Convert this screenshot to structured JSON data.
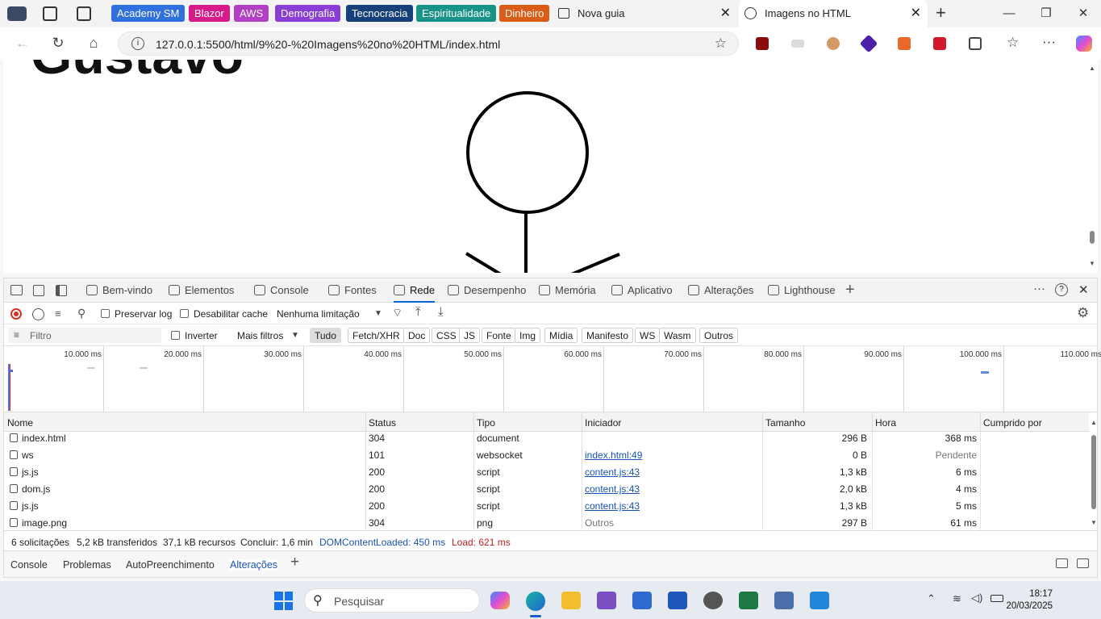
{
  "browser": {
    "favorites": [
      {
        "label": "Academy SM",
        "color": "#2f6fde"
      },
      {
        "label": "Blazor",
        "color": "#d61a8a"
      },
      {
        "label": "AWS",
        "color": "#b23fc4"
      },
      {
        "label": "Demografia",
        "color": "#8b3ed6"
      },
      {
        "label": "Tecnocracia",
        "color": "#16407a"
      },
      {
        "label": "Espiritualidade",
        "color": "#179387"
      },
      {
        "label": "Dinheiro",
        "color": "#d95d16"
      }
    ],
    "tabs": [
      {
        "title": "Nova guia"
      },
      {
        "title": "Imagens no HTML"
      }
    ],
    "url": "127.0.0.1:5500/html/9%20-%20Imagens%20no%20HTML/index.html"
  },
  "page": {
    "heading": "Gustavo"
  },
  "devtools": {
    "tabs": [
      "Bem-vindo",
      "Elementos",
      "Console",
      "Fontes",
      "Rede",
      "Desempenho",
      "Memória",
      "Aplicativo",
      "Alterações",
      "Lighthouse"
    ],
    "toolbar": {
      "preserve_log": "Preservar log",
      "disable_cache": "Desabilitar cache",
      "throttling": "Nenhuma limitação"
    },
    "filter": {
      "placeholder": "Filtro",
      "invert": "Inverter",
      "more_filters": "Mais filtros",
      "types": [
        "Tudo",
        "Fetch/XHR",
        "Doc",
        "CSS",
        "JS",
        "Fonte",
        "Img",
        "Mídia",
        "Manifesto",
        "WS",
        "Wasm",
        "Outros"
      ]
    },
    "timeline_ticks": [
      "10.000 ms",
      "20.000 ms",
      "30.000 ms",
      "40.000 ms",
      "50.000 ms",
      "60.000 ms",
      "70.000 ms",
      "80.000 ms",
      "90.000 ms",
      "100.000 ms",
      "110.000 ms"
    ],
    "columns": [
      "Nome",
      "Status",
      "Tipo",
      "Iniciador",
      "Tamanho",
      "Hora",
      "Cumprido por"
    ],
    "rows": [
      {
        "name": "index.html",
        "status": "304",
        "type": "document",
        "initiator": "",
        "size": "296 B",
        "time": "368 ms"
      },
      {
        "name": "ws",
        "status": "101",
        "type": "websocket",
        "initiator": "index.html:49",
        "size": "0 B",
        "time": "Pendente"
      },
      {
        "name": "js.js",
        "status": "200",
        "type": "script",
        "initiator": "content.js:43",
        "size": "1,3 kB",
        "time": "6 ms"
      },
      {
        "name": "dom.js",
        "status": "200",
        "type": "script",
        "initiator": "content.js:43",
        "size": "2,0 kB",
        "time": "4 ms"
      },
      {
        "name": "js.js",
        "status": "200",
        "type": "script",
        "initiator": "content.js:43",
        "size": "1,3 kB",
        "time": "5 ms"
      },
      {
        "name": "image.png",
        "status": "304",
        "type": "png",
        "initiator": "Outros",
        "size": "297 B",
        "time": "61 ms"
      }
    ],
    "summary": {
      "requests": "6 solicitações",
      "transferred": "5,2 kB transferidos",
      "resources": "37,1 kB recursos",
      "finish": "Concluir: 1,6 min",
      "dcl": "DOMContentLoaded: 450 ms",
      "load": "Load: 621 ms"
    },
    "drawer_tabs": [
      "Console",
      "Problemas",
      "AutoPreenchimento",
      "Alterações"
    ]
  },
  "taskbar": {
    "search_placeholder": "Pesquisar",
    "time": "18:17",
    "date": "20/03/2025"
  }
}
